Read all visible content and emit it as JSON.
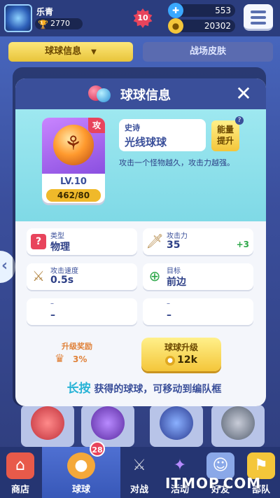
{
  "topbar": {
    "player_name": "乐青",
    "trophies": "2770",
    "level": "10",
    "energy": "553",
    "coins": "20302"
  },
  "tabs": {
    "active": "球球信息",
    "inactive": "战场皮肤"
  },
  "modal": {
    "title": "球球信息",
    "rarity": "史诗",
    "ball_name": "光线球球",
    "attack_tag": "攻",
    "level": "LV.10",
    "progress_text": "462/80",
    "progress_fraction": 1.0,
    "upgrade_energy": "能量提升",
    "description": "攻击一个怪物越久，攻击力越强。",
    "stats": [
      {
        "label": "类型",
        "value": "物理",
        "extra": "",
        "icon": "question-icon"
      },
      {
        "label": "攻击力",
        "value": "35",
        "extra": "+3",
        "icon": "sword-icon"
      },
      {
        "label": "攻击速度",
        "value": "0.5s",
        "extra": "",
        "icon": "crossed-swords-icon"
      },
      {
        "label": "目标",
        "value": "前边",
        "extra": "",
        "icon": "target-icon"
      },
      {
        "label": "–",
        "value": "–",
        "extra": "",
        "icon": ""
      },
      {
        "label": "–",
        "value": "–",
        "extra": "",
        "icon": ""
      }
    ],
    "reward_label": "升级奖励",
    "reward_value": "3%",
    "upgrade_label": "球球升级",
    "upgrade_cost": "12k",
    "hint_emphasis": "长按",
    "hint_rest": "获得的球球，可移动到编队框"
  },
  "bottomnav": {
    "items": [
      {
        "label": "商店",
        "icon": "shop-icon"
      },
      {
        "label": "球球",
        "icon": "ball-icon"
      },
      {
        "label": "对战",
        "icon": "battle-icon"
      },
      {
        "label": "活动",
        "icon": "event-icon"
      },
      {
        "label": "好友",
        "icon": "friends-icon"
      },
      {
        "label": "部队",
        "icon": "clan-icon"
      }
    ],
    "badge": "28"
  },
  "watermark": "ITMOP.COM",
  "colors": {
    "accent_yellow": "#f4c63a",
    "header_blue": "#3a4f9a",
    "cyan": "#9ee8f0",
    "badge_red": "#e8445c"
  }
}
